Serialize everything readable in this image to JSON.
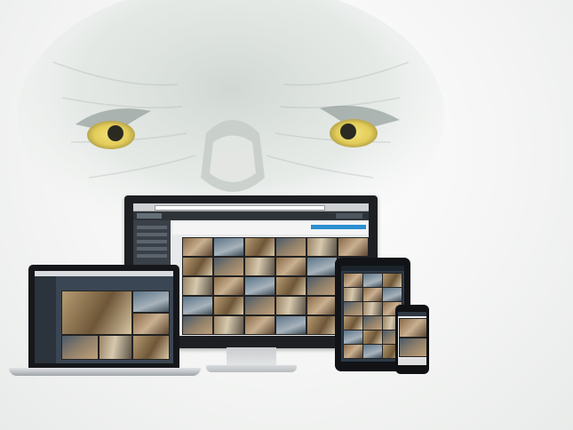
{
  "monitor": {
    "header_title": "",
    "sidebar_items": [
      "",
      "",
      "",
      "",
      ""
    ]
  },
  "palette": {
    "background": "#f2f3f2",
    "device_frame": "#1d1f22",
    "eagle_eye": "#e3cd5a",
    "ui_accent": "#2a8fd0"
  }
}
